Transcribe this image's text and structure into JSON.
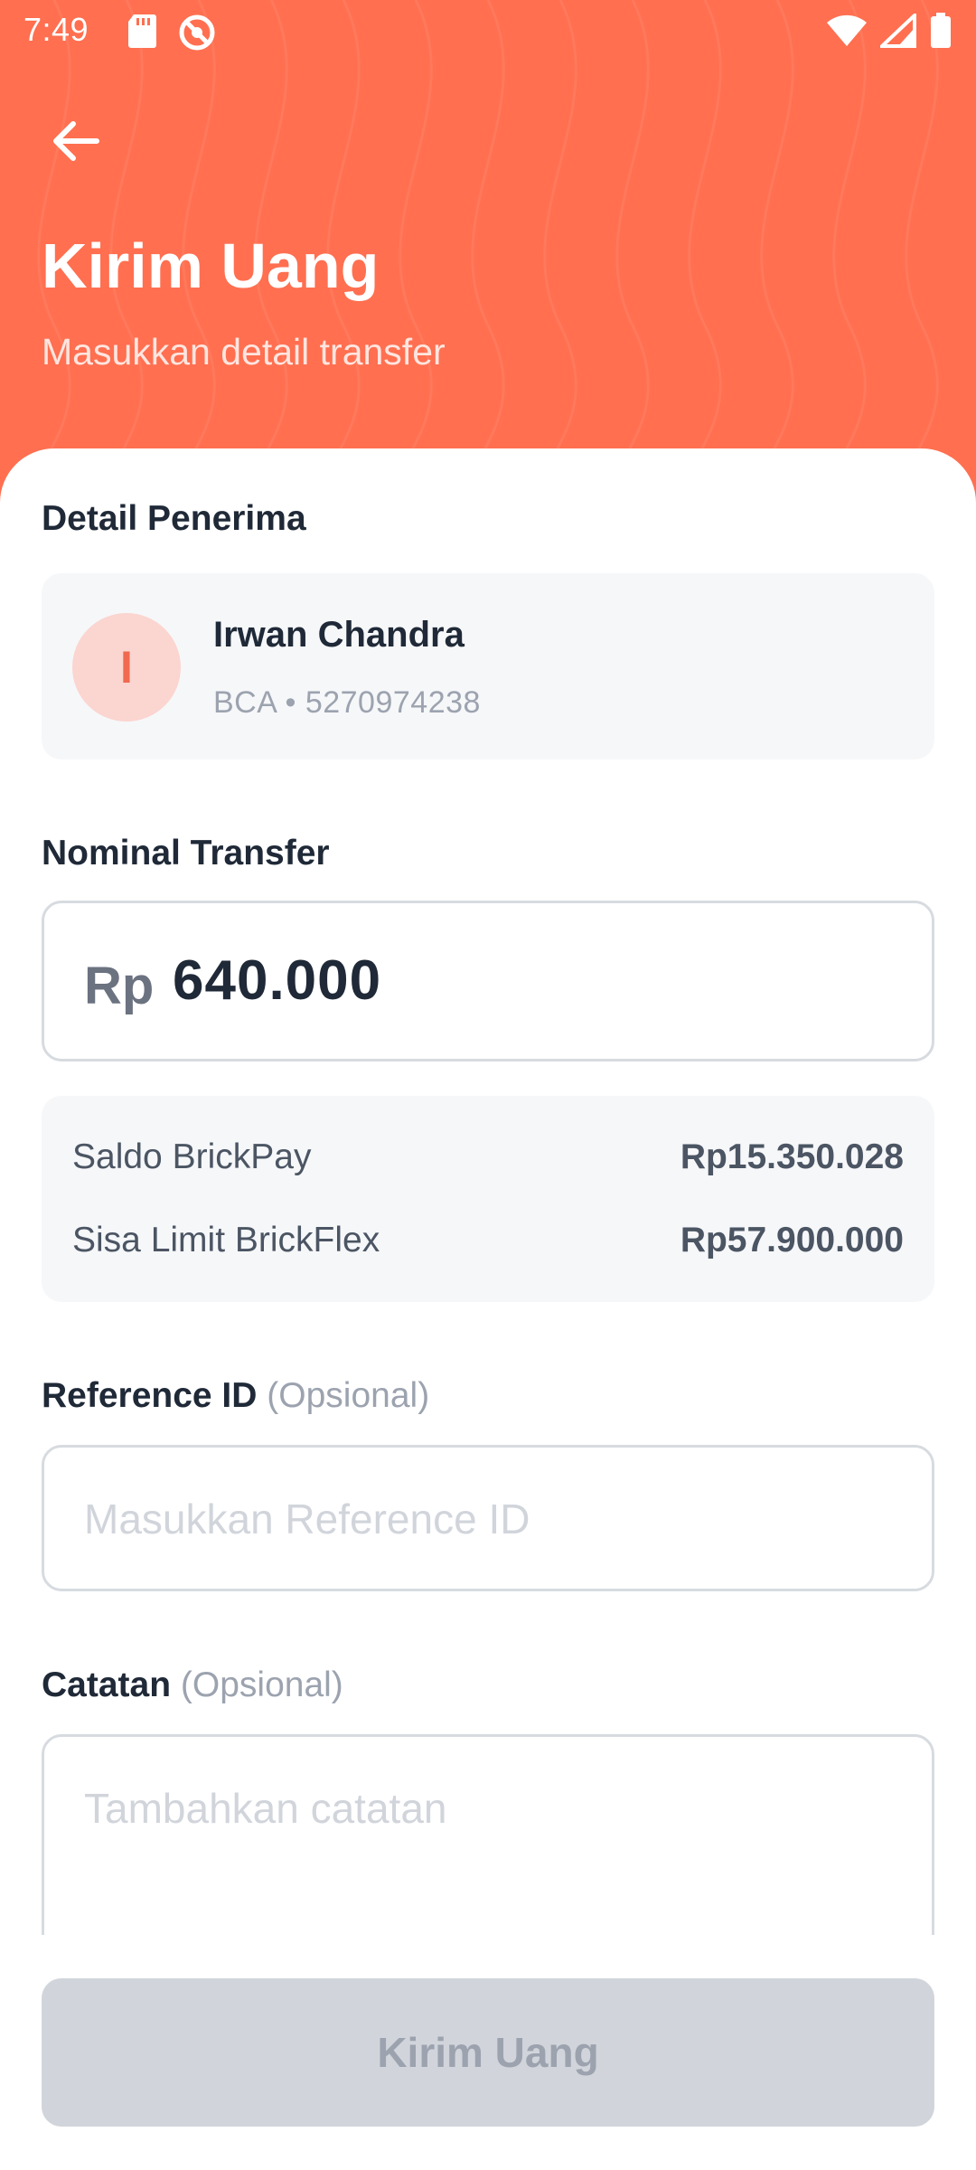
{
  "status_bar": {
    "time": "7:49",
    "icons_left": [
      "sd-card-icon",
      "data-saver-icon"
    ],
    "icons_right": [
      "wifi-icon",
      "signal-icon",
      "battery-icon"
    ]
  },
  "header": {
    "back_icon": "arrow-left-icon",
    "title": "Kirim Uang",
    "subtitle": "Masukkan detail transfer"
  },
  "recipient": {
    "section_label": "Detail Penerima",
    "avatar_initial": "I",
    "name": "Irwan Chandra",
    "account": "BCA • 5270974238"
  },
  "amount": {
    "section_label": "Nominal Transfer",
    "currency": "Rp",
    "value": "640.000"
  },
  "balances": {
    "saldo_label": "Saldo BrickPay",
    "saldo_value": "Rp15.350.028",
    "limit_label": "Sisa Limit BrickFlex",
    "limit_value": "Rp57.900.000"
  },
  "reference": {
    "label": "Reference ID",
    "optional": "(Opsional)",
    "placeholder": "Masukkan Reference ID"
  },
  "note": {
    "label": "Catatan",
    "optional": "(Opsional)",
    "placeholder": "Tambahkan catatan"
  },
  "submit": {
    "label": "Kirim Uang",
    "enabled": false
  },
  "colors": {
    "header_bg": "#ff6f50",
    "avatar_bg": "#fbd5d0",
    "avatar_text": "#ef6a4f",
    "button_disabled_bg": "#d1d5db",
    "card_bg": "#f6f7f9"
  }
}
